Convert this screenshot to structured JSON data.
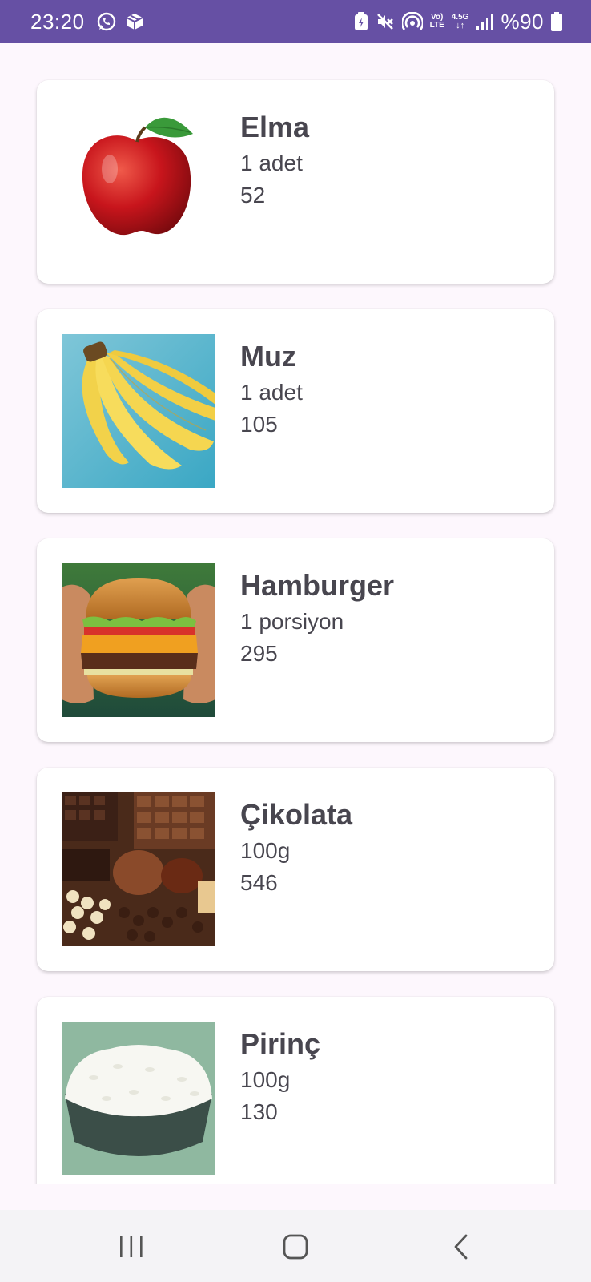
{
  "status_bar": {
    "time": "23:20",
    "battery_text": "%90",
    "network_top": "Vo)",
    "network_bottom": "LTE",
    "signal_gen": "4.5G",
    "icons": [
      "whatsapp-icon",
      "package-icon",
      "battery-saver-icon",
      "mute-icon",
      "hotspot-icon",
      "volte-icon",
      "data-arrows-icon",
      "signal-icon",
      "battery-icon"
    ]
  },
  "foods": [
    {
      "name": "Elma",
      "portion": "1 adet",
      "calories": "52",
      "image": "apple"
    },
    {
      "name": "Muz",
      "portion": "1 adet",
      "calories": "105",
      "image": "banana"
    },
    {
      "name": "Hamburger",
      "portion": "1 porsiyon",
      "calories": "295",
      "image": "hamburger"
    },
    {
      "name": "Çikolata",
      "portion": "100g",
      "calories": "546",
      "image": "chocolate"
    },
    {
      "name": "Pirinç",
      "portion": "100g",
      "calories": "130",
      "image": "rice"
    }
  ],
  "nav_bar": {
    "buttons": [
      "recent-apps-icon",
      "home-icon",
      "back-icon"
    ]
  },
  "colors": {
    "status_bar": "#6650a4",
    "background": "#fdf7fd",
    "card": "#ffffff",
    "text": "#48464f",
    "nav_bar": "#f4f3f6"
  }
}
